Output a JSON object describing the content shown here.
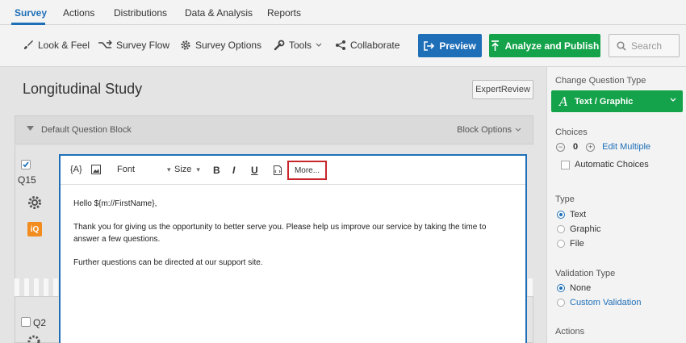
{
  "nav": {
    "tabs": [
      "Survey",
      "Actions",
      "Distributions",
      "Data & Analysis",
      "Reports"
    ]
  },
  "toolbar": {
    "look_feel": "Look & Feel",
    "survey_flow": "Survey Flow",
    "survey_options": "Survey Options",
    "tools": "Tools",
    "collaborate": "Collaborate",
    "preview": "Preview",
    "publish": "Analyze and Publish",
    "search_placeholder": "Search"
  },
  "main": {
    "title": "Longitudinal Study",
    "expert_review": "ExpertReview",
    "block_name": "Default Question Block",
    "block_options": "Block Options",
    "q1_label": "Q15",
    "q1_iq": "iQ",
    "q2_label": "Q2"
  },
  "editor": {
    "piped_text": "{A}",
    "font": "Font",
    "size": "Size",
    "bold": "B",
    "italic": "I",
    "underline": "U",
    "more": "More...",
    "paragraphs": [
      "Hello ${m://FirstName},",
      "Thank you for giving us the opportunity to better serve you. Please help us improve our service by taking the time to answer a few questions.",
      "Further questions can be directed at our support site."
    ]
  },
  "panel": {
    "change_type_heading": "Change Question Type",
    "question_type": "Text / Graphic",
    "choices_heading": "Choices",
    "choice_count": "0",
    "edit_multiple": "Edit Multiple",
    "automatic_choices": "Automatic Choices",
    "type_heading": "Type",
    "type_options": [
      "Text",
      "Graphic",
      "File"
    ],
    "validation_heading": "Validation Type",
    "validation_options": [
      "None",
      "Custom Validation"
    ],
    "actions_heading": "Actions"
  },
  "colors": {
    "accent_blue": "#1e6fb8",
    "publish_green": "#14a34a",
    "highlight_red": "#c8262b",
    "iq_orange": "#f28c1e"
  }
}
